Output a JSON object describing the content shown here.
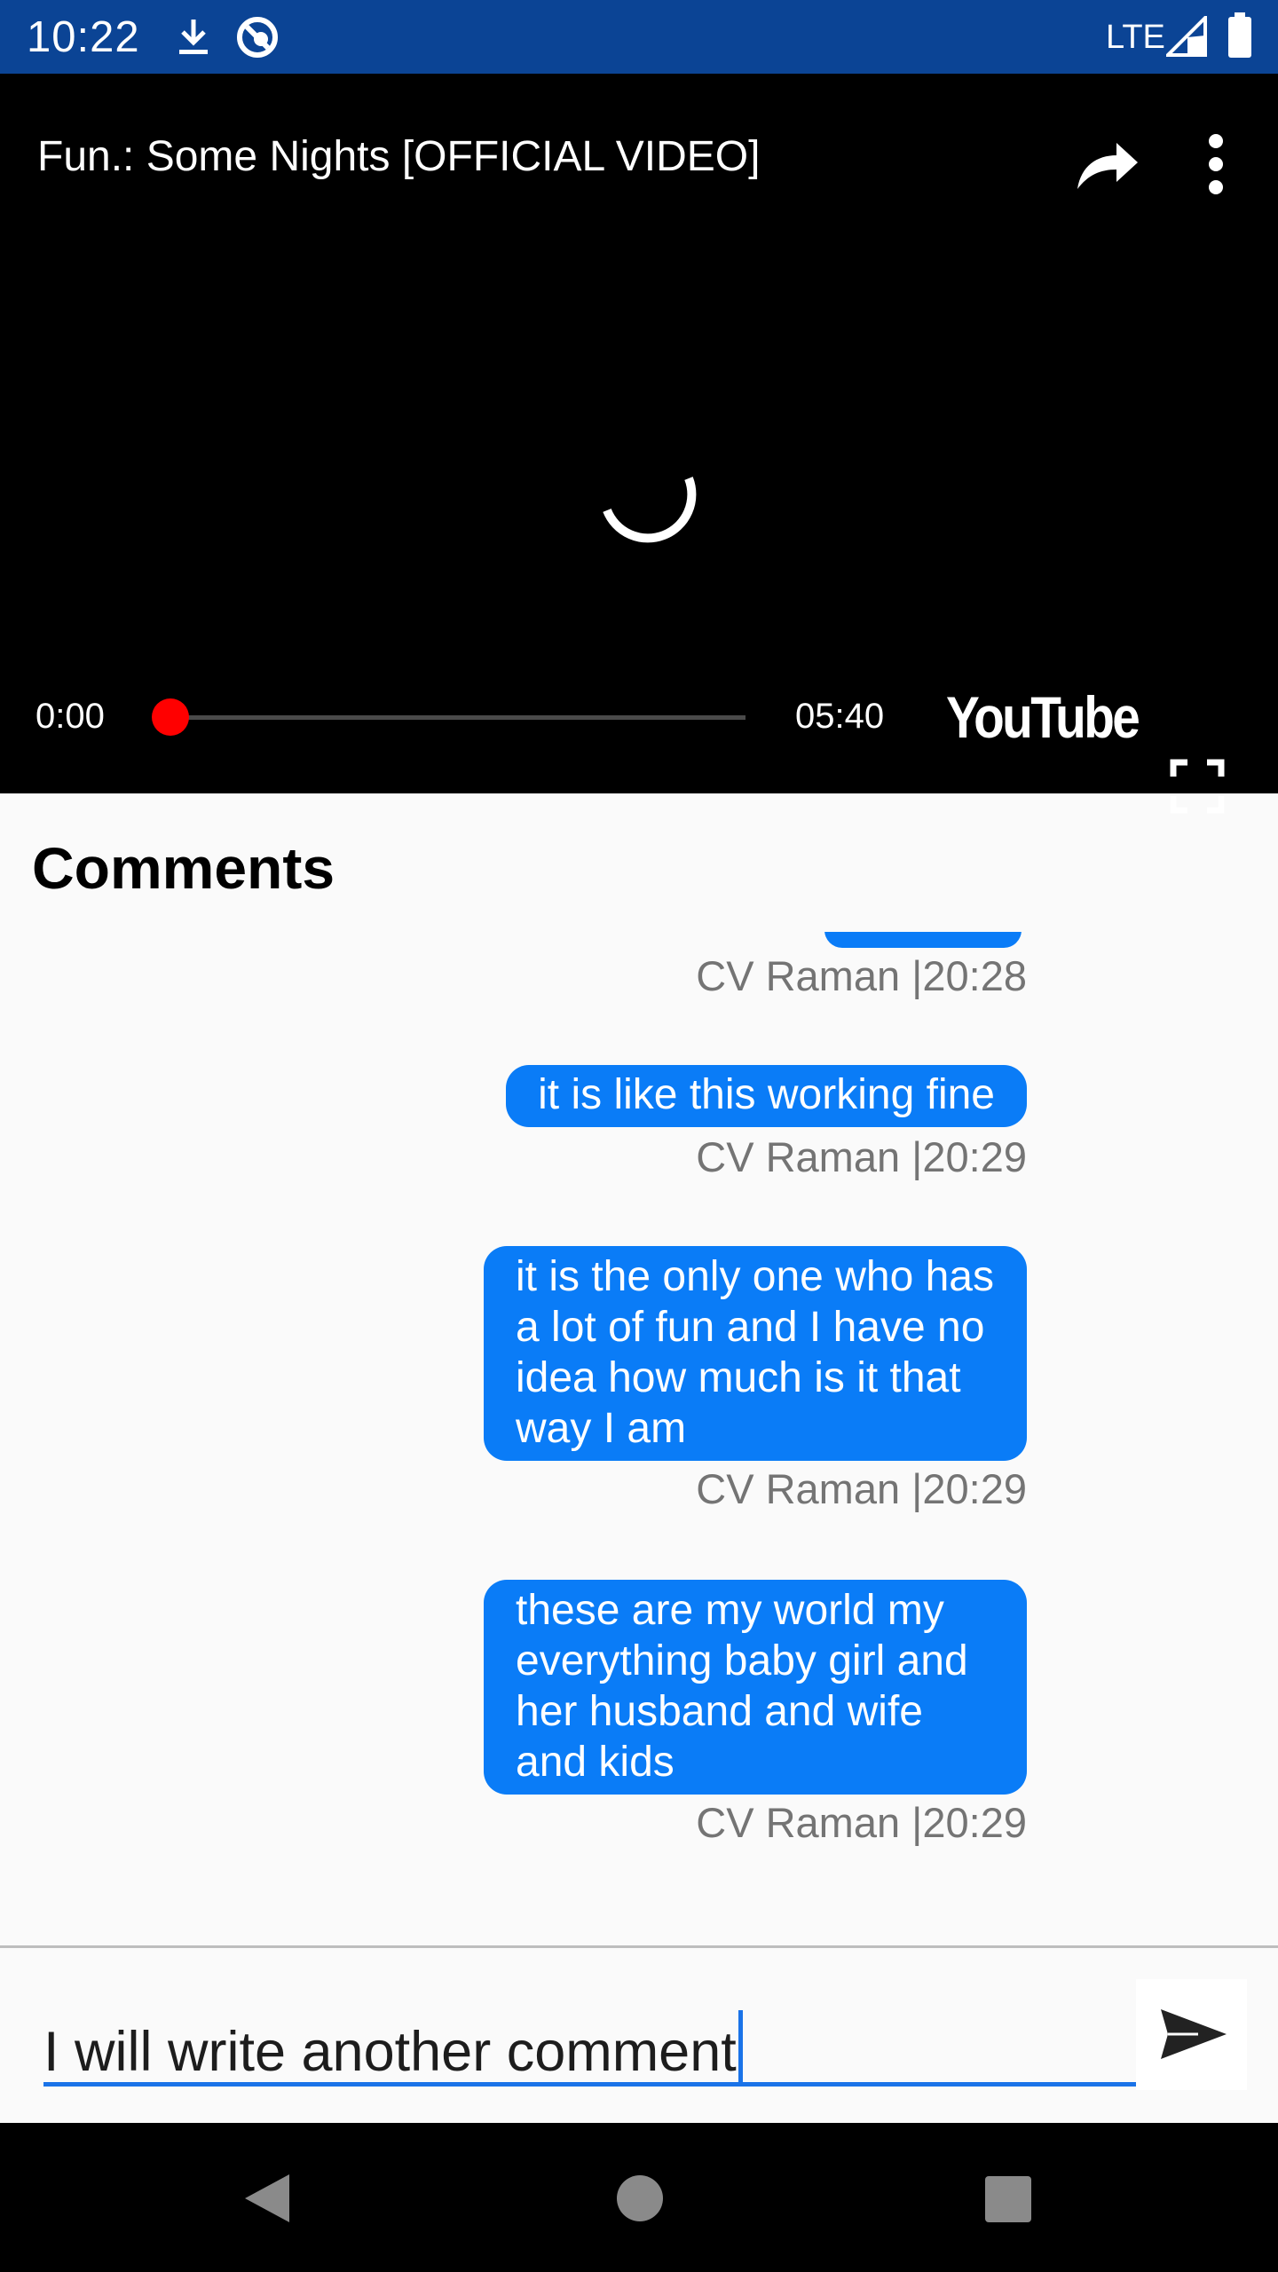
{
  "status_bar": {
    "time": "10:22",
    "network": "LTE",
    "icons": [
      "download-icon",
      "no-sync-icon",
      "signal-icon",
      "battery-icon"
    ]
  },
  "player": {
    "title": "Fun.: Some Nights [OFFICIAL VIDEO]",
    "current_time": "0:00",
    "duration": "05:40",
    "progress": 0,
    "logo_text": "YouTube",
    "icons": [
      "share-icon",
      "more-vert-icon",
      "loading-spinner-icon",
      "fullscreen-icon"
    ]
  },
  "comments": {
    "heading": "Comments",
    "items": [
      {
        "text": "",
        "meta": "CV Raman |20:28"
      },
      {
        "text": "it is like this working fine",
        "meta": "CV Raman |20:29"
      },
      {
        "text": "it is the only one who has a lot of fun and I have no idea how much is it that way I am",
        "meta": "CV Raman |20:29"
      },
      {
        "text": "these are my world my everything baby girl and her husband and wife and kids",
        "meta": "CV Raman |20:29"
      }
    ]
  },
  "input": {
    "value": "I will write another comment"
  },
  "nav": {
    "icons": [
      "back-icon",
      "home-icon",
      "recents-icon"
    ]
  },
  "colors": {
    "status_bar": "#0b4495",
    "bubble": "#0a7cf7",
    "accent": "#1a73e8",
    "seek_knob": "#ff0000"
  }
}
